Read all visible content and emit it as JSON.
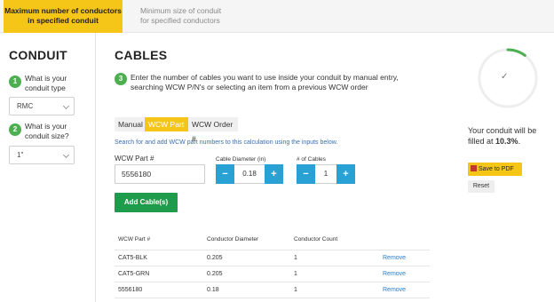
{
  "tabs": [
    {
      "label_line1": "Maximum number of conductors",
      "label_line2": "in specified conduit"
    },
    {
      "label_line1": "Minimum size of conduit",
      "label_line2": "for specified conductors"
    }
  ],
  "conduit": {
    "heading": "CONDUIT",
    "step1": {
      "num": "1",
      "line1": "What is your",
      "line2": "conduit type",
      "value": "RMC"
    },
    "step2": {
      "num": "2",
      "line1": "What is your",
      "line2": "conduit size?",
      "value": "1\""
    }
  },
  "cables": {
    "heading": "CABLES",
    "step3": {
      "num": "3",
      "text": "Enter the number of cables you want to use inside your conduit by manual entry, searching WCW P/N's or selecting an item from a previous WCW order"
    },
    "entry_tabs": [
      "Manual",
      "WCW Part #",
      "WCW Order #"
    ],
    "search_hint": "Search for and add WCW part numbers to this calculation using the inputs below.",
    "part_label": "WCW Part #",
    "part_value": "5556180",
    "diameter_label": "Cable Diameter (in)",
    "diameter_value": "0.18",
    "count_label": "# of Cables",
    "count_value": "1",
    "minus": "−",
    "plus": "+",
    "add_button": "Add Cable(s)"
  },
  "table": {
    "headers": [
      "WCW Part #",
      "Conductor Diameter",
      "Conductor Count"
    ],
    "rows": [
      {
        "part": "CAT5-BLK",
        "diameter": "0.205",
        "count": "1",
        "action": "Remove"
      },
      {
        "part": "CAT5-GRN",
        "diameter": "0.205",
        "count": "1",
        "action": "Remove"
      },
      {
        "part": "5556180",
        "diameter": "0.18",
        "count": "1",
        "action": "Remove"
      }
    ]
  },
  "result": {
    "fill_fraction": 0.103,
    "check": "✓",
    "text_line1": "Your conduit will be",
    "text_prefix": "filled at ",
    "percent": "10.3%",
    "text_suffix": ".",
    "pdf_button": "Save to PDF",
    "reset_button": "Reset",
    "colors": {
      "ring_fill": "#4caf50",
      "ring_track": "#eeeeee"
    }
  }
}
